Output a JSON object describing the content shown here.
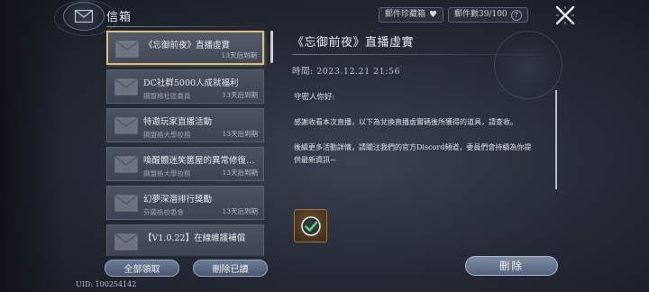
{
  "header": {
    "title": "信箱",
    "collection_label": "郵件珍藏箱",
    "mail_count_label": "郵件數39/100",
    "help_label": "?"
  },
  "mail_list": [
    {
      "subject": "《忘御前夜》直播虛實",
      "sender": "",
      "expiry": "13天后到期",
      "selected": true
    },
    {
      "subject": "DC社群5000人成就福利",
      "sender": "鋼盟格社區委員",
      "expiry": "13天后到期"
    },
    {
      "subject": "特邀玩家直播活動",
      "sender": "鋼盟格大學校務",
      "expiry": "13天后到期"
    },
    {
      "subject": "喚醒體迷笑篋屋的異常修復…",
      "sender": "鋼盟格大學校務",
      "expiry": "13天后到期"
    },
    {
      "subject": "幻夢深潛排行獎勵",
      "sender": "芬薩格校委會",
      "expiry": "13天后到期"
    },
    {
      "subject": "【V1.0.22】在線維護補償",
      "sender": "",
      "expiry": ""
    }
  ],
  "buttons": {
    "claim_all": "全部領取",
    "delete_read": "刪除已讀",
    "delete": "刪除"
  },
  "uid": "UID: 100254142",
  "detail": {
    "title": "《忘御前夜》直播虛實",
    "time": "時間: 2023.12.21 21:56",
    "greeting": "守密人你好:",
    "paragraph1": "感謝收看本次直播，以下為兌換直播虛實碼後所獲得的道具，請查收。",
    "paragraph2": "後續更多活動詳情，請關注我們的官方Discord頻道，委員們會持續為你提供最新資訊~"
  },
  "icons": {
    "header": "mail-emblem-icon",
    "close": "close-icon",
    "heart": "heart-icon",
    "help": "help-icon",
    "mail": "envelope-icon",
    "attachment": "claimed-check-icon"
  },
  "colors": {
    "selected_border": "#d9c07e",
    "item_bg": "#454b58",
    "button": "#5f6d86",
    "attachment_border": "#9a7a44",
    "check": "#5fc98f"
  }
}
